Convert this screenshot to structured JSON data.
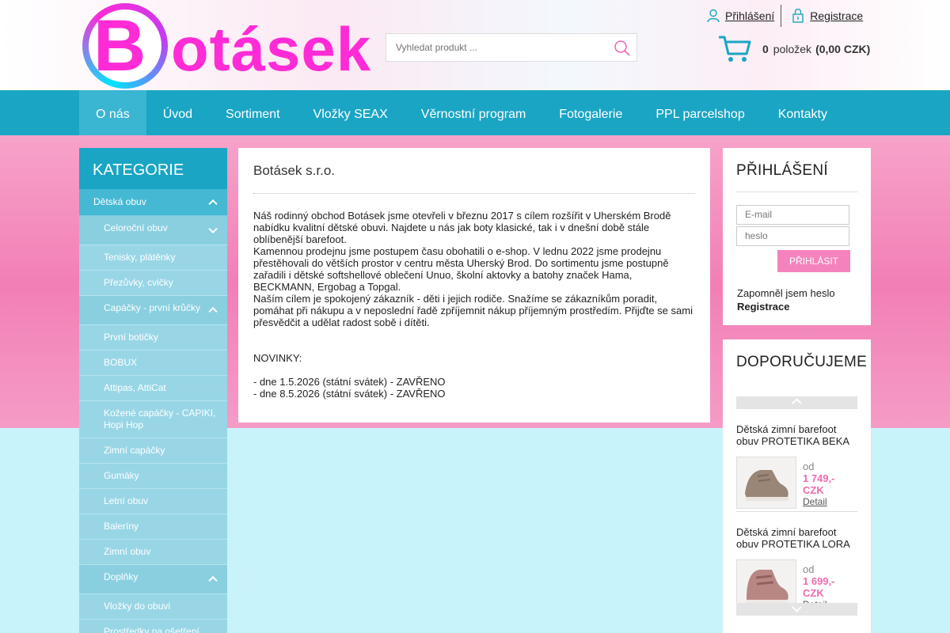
{
  "header": {
    "logo_text": "Botásek",
    "search_placeholder": "Vyhledat produkt ...",
    "login_link": "Přihlášení",
    "register_link": "Registrace",
    "cart": {
      "count": "0",
      "items_label": "položek",
      "total": "(0,00 CZK)"
    }
  },
  "nav": {
    "items": [
      {
        "label": "O nás"
      },
      {
        "label": "Úvod"
      },
      {
        "label": "Sortiment"
      },
      {
        "label": "Vložky SEAX"
      },
      {
        "label": "Věrnostní program"
      },
      {
        "label": "Fotogalerie"
      },
      {
        "label": "PPL parcelshop"
      },
      {
        "label": "Kontakty"
      }
    ],
    "active": "O nás"
  },
  "sidebar": {
    "title": "KATEGORIE",
    "top_category": "Dětská obuv",
    "items": [
      {
        "label": "Celoroční obuv"
      },
      {
        "label": "Tenisky, plátěnky"
      },
      {
        "label": "Přezůvky, cvičky"
      },
      {
        "label": "Capáčky - první krůčky"
      },
      {
        "label": "První botičky"
      },
      {
        "label": "BOBUX"
      },
      {
        "label": "Attipas, AttiCat"
      },
      {
        "label": "Kožené capáčky - CAPIKI, Hopi Hop"
      },
      {
        "label": "Zimní capáčky"
      },
      {
        "label": "Gumáky"
      },
      {
        "label": "Letní obuv"
      },
      {
        "label": "Baleríny"
      },
      {
        "label": "Zimní obuv"
      },
      {
        "label": "Doplňky"
      },
      {
        "label": "Vložky do obuvi"
      },
      {
        "label": "Prostředky na ošetření obuvi"
      }
    ]
  },
  "main": {
    "title": "Botásek s.r.o.",
    "p1": "Náš rodinný obchod Botásek jsme otevřeli v březnu 2017 s cílem rozšířit v Uherském Brodě nabídku kvalitní dětské obuvi. Najdete u nás jak boty klasické, tak i v dnešní době stále oblíbenější barefoot.",
    "p2": "Kamennou prodejnu jsme postupem času obohatili o e-shop. V lednu 2022 jsme prodejnu přestěhovali do větších prostor v centru města Uherský Brod. Do sortimentu jsme postupně zařadili i dětské softshellové oblečení Unuo, školní aktovky a batohy značek Hama, BECKMANN, Ergobag a Topgal.",
    "p3": "Naším cílem je spokojený zákazník - děti i jejich rodiče. Snažíme se zákazníkům poradit, pomáhat při nákupu a v neposlední řadě zpříjemnit nákup příjemným prostředím. Přijďte se sami přesvědčit a udělat radost sobě i dítěti.",
    "news_title": "NOVINKY:",
    "news1": "- dne 1.5.2026 (státní svátek) - ZAVŘENO",
    "news2": "- dne 8.5.2026 (státní svátek) - ZAVŘENO"
  },
  "login_box": {
    "title": "PŘIHLÁŠENÍ",
    "email_placeholder": "E-mail",
    "password_placeholder": "heslo",
    "submit": "PŘIHLÁSIT",
    "forgot": "Zapomněl jsem heslo",
    "register": "Registrace"
  },
  "recommend": {
    "title": "DOPORUČUJEME",
    "products": [
      {
        "name": "Dětská zimní barefoot obuv PROTETIKA BEKA",
        "od": "od",
        "price": "1 749,- CZK",
        "detail": "Detail",
        "color": "#9a8676"
      },
      {
        "name": "Dětská zimní barefoot obuv PROTETIKA LORA",
        "od": "od",
        "price": "1 699,- CZK",
        "detail": "Detail",
        "color": "#b98783"
      }
    ]
  }
}
